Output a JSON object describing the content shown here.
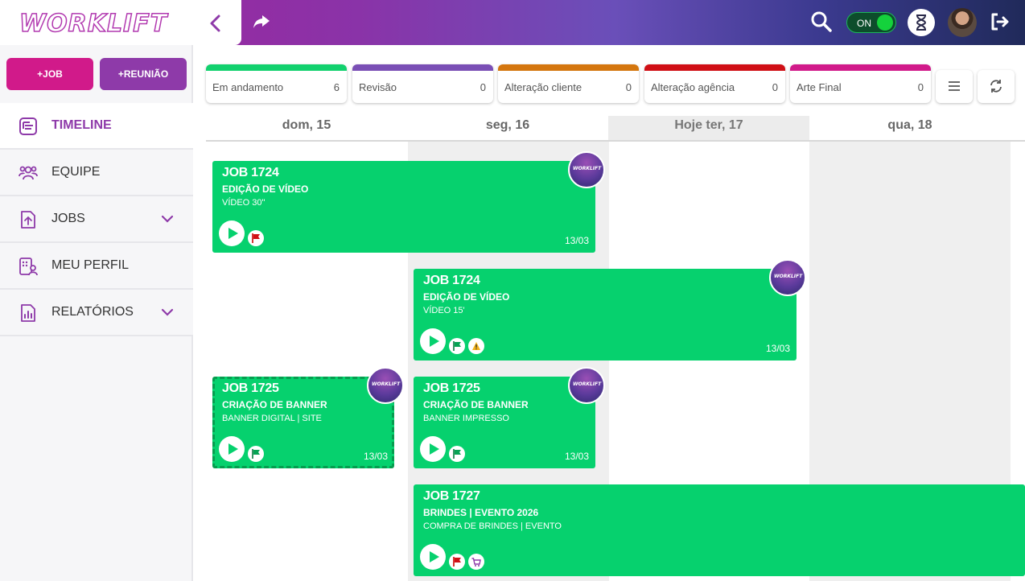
{
  "app": {
    "logo_text": "WORKLIFT"
  },
  "topbar": {
    "toggle_label": "ON",
    "icons": [
      "chevron-left-icon",
      "share-icon",
      "search-icon",
      "hourglass-icon",
      "user-avatar",
      "logout-icon"
    ]
  },
  "sidebar": {
    "add_job_label": "+JOB",
    "add_meeting_label": "+REUNIÃO",
    "items": [
      {
        "label": "TIMELINE",
        "icon": "timeline-icon",
        "active": true
      },
      {
        "label": "EQUIPE",
        "icon": "team-icon"
      },
      {
        "label": "JOBS",
        "icon": "jobs-upload-icon",
        "expandable": true
      },
      {
        "label": "MEU PERFIL",
        "icon": "profile-icon"
      },
      {
        "label": "RELATÓRIOS",
        "icon": "reports-icon",
        "expandable": true
      }
    ]
  },
  "statuses": [
    {
      "label": "Em andamento",
      "count": "6",
      "color": "#12d16e"
    },
    {
      "label": "Revisão",
      "count": "0",
      "color": "#7a4fb5"
    },
    {
      "label": "Alteração cliente",
      "count": "0",
      "color": "#d4760e"
    },
    {
      "label": "Alteração agência",
      "count": "0",
      "color": "#d00f15"
    },
    {
      "label": "Arte Final",
      "count": "0",
      "color": "#d11a8a"
    }
  ],
  "days": [
    {
      "label": "dom, 15"
    },
    {
      "label": "seg, 16"
    },
    {
      "label": "Hoje ter, 17",
      "today": true
    },
    {
      "label": "qua, 18"
    }
  ],
  "jobs": [
    {
      "title": "JOB 1724",
      "subtitle": "EDIÇÃO DE VÍDEO",
      "desc": "VÍDEO 30\"",
      "date": "13/03",
      "flags": [
        "red-flag"
      ]
    },
    {
      "title": "JOB 1724",
      "subtitle": "EDIÇÃO DE VÍDEO",
      "desc": "VÍDEO 15'",
      "date": "13/03",
      "flags": [
        "green-flag",
        "warning"
      ]
    },
    {
      "title": "JOB 1725",
      "subtitle": "CRIAÇÃO DE BANNER",
      "desc": "BANNER DIGITAL | SITE",
      "date": "13/03",
      "flags": [
        "green-flag"
      ]
    },
    {
      "title": "JOB 1725",
      "subtitle": "CRIAÇÃO DE BANNER",
      "desc": "BANNER IMPRESSO",
      "date": "13/03",
      "flags": [
        "green-flag"
      ]
    },
    {
      "title": "JOB 1727",
      "subtitle": "BRINDES | EVENTO 2026",
      "desc": "COMPRA DE BRINDES | EVENTO",
      "date": "",
      "flags": [
        "red-flag",
        "cart"
      ]
    }
  ],
  "colors": {
    "accent_purple": "#8e3aa9",
    "accent_pink": "#d11a8a",
    "job_green": "#06d16e"
  }
}
